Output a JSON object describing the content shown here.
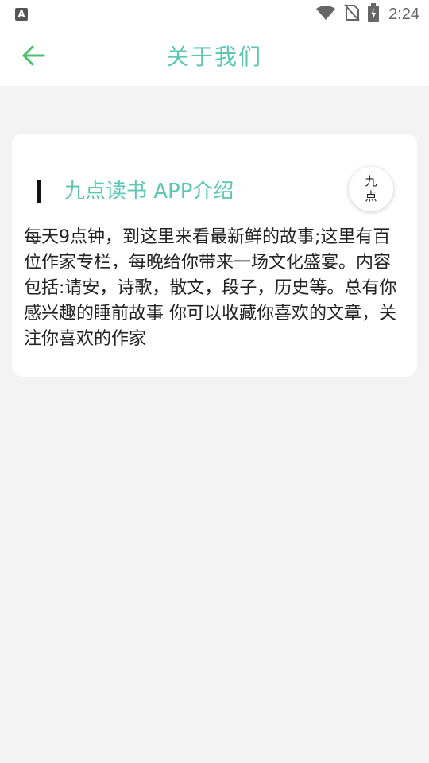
{
  "status_bar": {
    "notification_letter": "A",
    "time": "2:24",
    "icons": [
      "wifi-icon",
      "no-sim-icon",
      "battery-charging-icon"
    ]
  },
  "header": {
    "title": "关于我们",
    "back_icon": "arrow-left-icon",
    "accent_color": "#5cc8b4",
    "back_color": "#4cbf6b"
  },
  "card": {
    "title": "九点读书 APP介绍",
    "badge": "九点",
    "body": "每天9点钟，到这里来看最新鲜的故事;这里有百位作家专栏，每晚给你带来一场文化盛宴。内容包括:请安，诗歌，散文，段子，历史等。总有你感兴趣的睡前故事 你可以收藏你喜欢的文章，关注你喜欢的作家"
  }
}
